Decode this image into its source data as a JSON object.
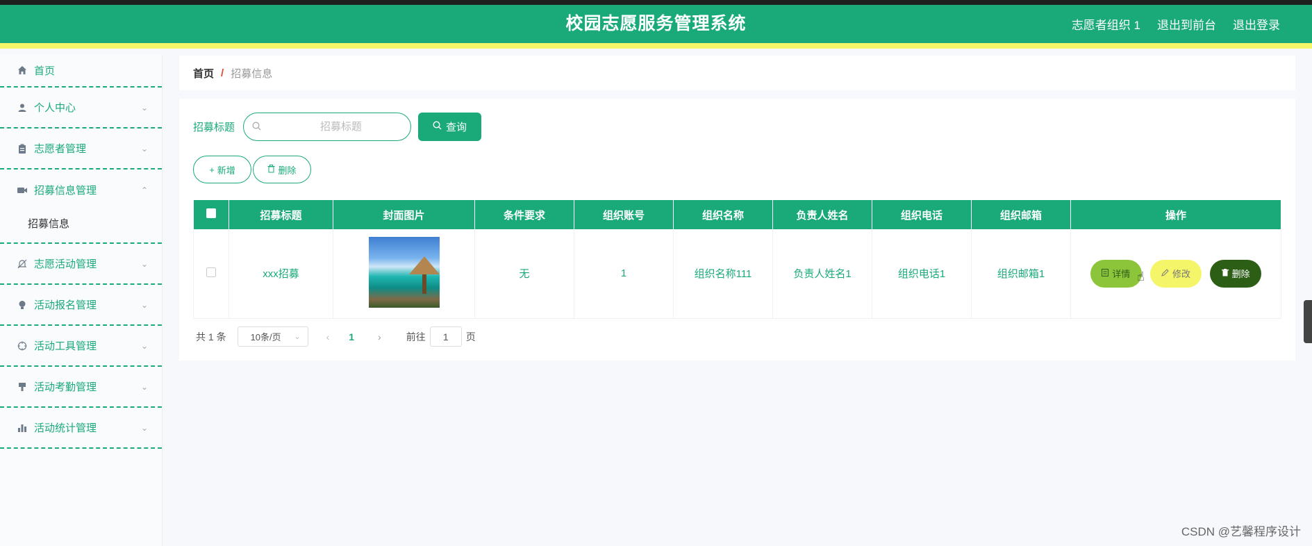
{
  "header": {
    "title": "校园志愿服务管理系统",
    "user": "志愿者组织 1",
    "to_front": "退出到前台",
    "logout": "退出登录"
  },
  "sidebar": {
    "home": "首页",
    "items": [
      {
        "label": "个人中心",
        "icon": "user-icon",
        "arrow": "chevron-down-icon"
      },
      {
        "label": "志愿者管理",
        "icon": "clipboard-icon",
        "arrow": "chevron-down-icon"
      },
      {
        "label": "招募信息管理",
        "icon": "video-icon",
        "arrow": "chevron-up-icon"
      },
      {
        "label": "志愿活动管理",
        "icon": "bell-off-icon",
        "arrow": "chevron-down-icon"
      },
      {
        "label": "活动报名管理",
        "icon": "bulb-icon",
        "arrow": "chevron-down-icon"
      },
      {
        "label": "活动工具管理",
        "icon": "target-icon",
        "arrow": "chevron-down-icon"
      },
      {
        "label": "活动考勤管理",
        "icon": "brush-icon",
        "arrow": "chevron-down-icon"
      },
      {
        "label": "活动统计管理",
        "icon": "chart-icon",
        "arrow": "chevron-down-icon"
      }
    ],
    "submenu": "招募信息"
  },
  "breadcrumb": {
    "home": "首页",
    "sep": "/",
    "current": "招募信息"
  },
  "search": {
    "label": "招募标题",
    "placeholder": "招募标题",
    "button": "查询"
  },
  "actions": {
    "add": "新增",
    "delete": "删除"
  },
  "table": {
    "headers": [
      "招募标题",
      "封面图片",
      "条件要求",
      "组织账号",
      "组织名称",
      "负责人姓名",
      "组织电话",
      "组织邮箱",
      "操作"
    ],
    "rows": [
      {
        "title": "xxx招募",
        "condition": "无",
        "account": "1",
        "org_name": "组织名称111",
        "leader": "负责人姓名1",
        "phone": "组织电话1",
        "email": "组织邮箱1"
      }
    ],
    "ops": {
      "detail": "详情",
      "edit": "修改",
      "delete": "删除"
    }
  },
  "pager": {
    "total": "共 1 条",
    "size": "10条/页",
    "page": "1",
    "goto_label": "前往",
    "goto_value": "1",
    "goto_suffix": "页"
  },
  "watermark": "CSDN @艺馨程序设计",
  "colors": {
    "primary": "#1aaa7a",
    "accent_yellow": "#f5f56a",
    "detail_green": "#8dc53a",
    "delete_dark": "#2d5e16"
  }
}
